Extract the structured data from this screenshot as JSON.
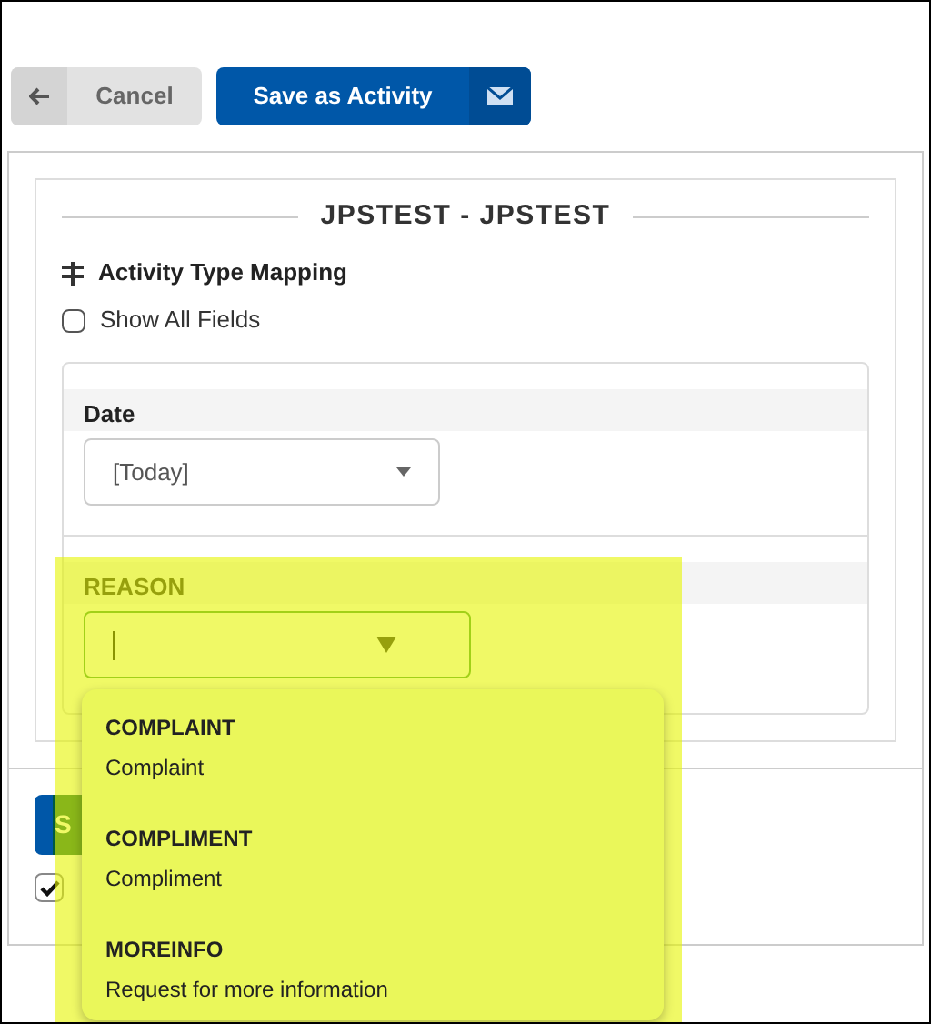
{
  "toolbar": {
    "cancel": {
      "label": "Cancel"
    },
    "save": {
      "label": "Save as Activity"
    }
  },
  "panel": {
    "title": "JPSTEST - JPSTEST",
    "section": "Activity Type Mapping",
    "show_all_fields": {
      "label": "Show All Fields",
      "checked": false
    }
  },
  "fields": [
    {
      "label": "Date",
      "value": "[Today]"
    },
    {
      "label": "REASON"
    }
  ],
  "dropdown": {
    "options": [
      {
        "code": "COMPLAINT",
        "description": "Complaint"
      },
      {
        "code": "COMPLIMENT",
        "description": "Compliment"
      },
      {
        "code": "MOREINFO",
        "description": "Request for more information"
      }
    ]
  },
  "footer": {
    "button": {
      "label": "S"
    },
    "checkbox": {
      "checked": true
    }
  },
  "highlight": {
    "on": true
  }
}
